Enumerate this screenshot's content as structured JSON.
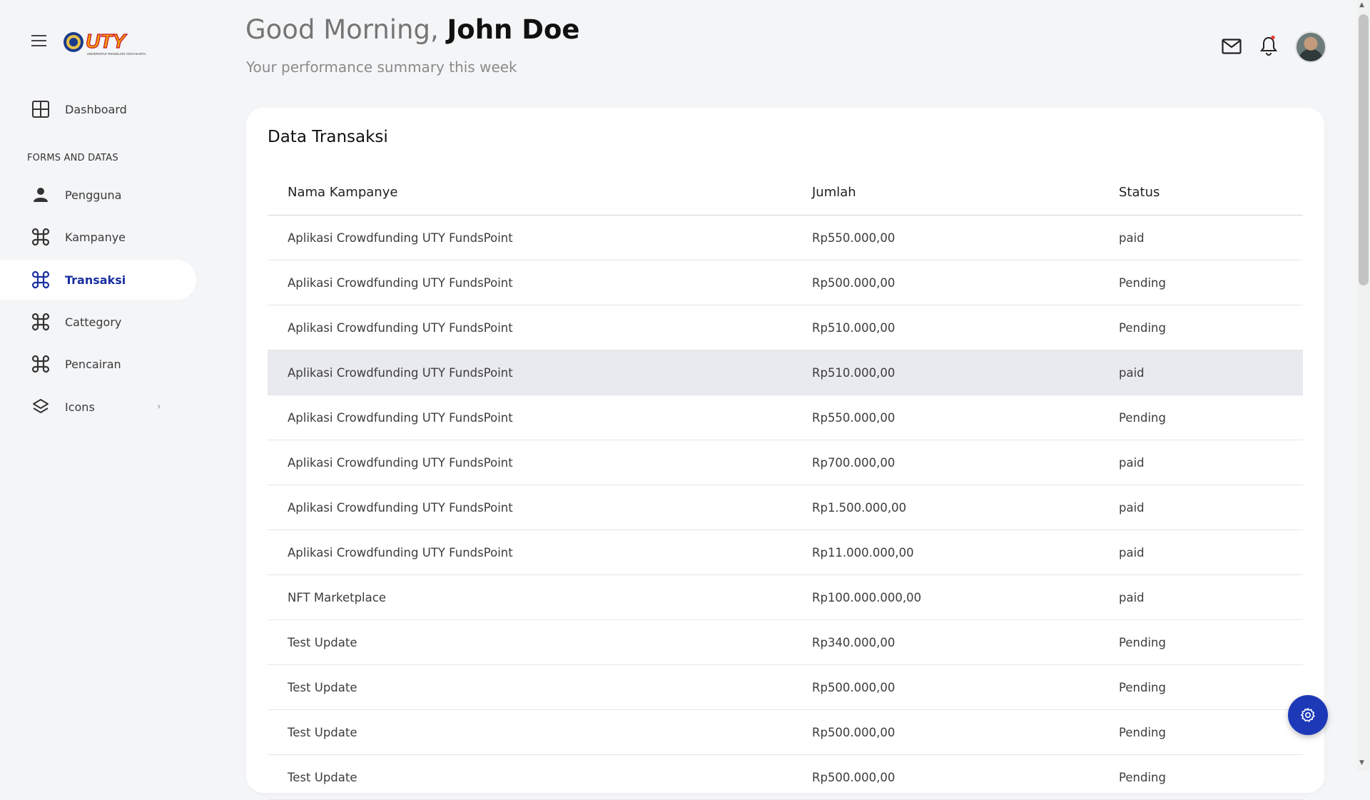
{
  "brand": {
    "logo_text": "UTY",
    "logo_subtext": "UNIVERSITAS TEKNOLOGI YOGYAKARTA"
  },
  "header": {
    "greeting": "Good Morning,",
    "user_name": "John Doe",
    "subtitle": "Your performance summary this week"
  },
  "sidebar": {
    "items_top": [
      {
        "label": "Dashboard",
        "icon": "grid-icon"
      }
    ],
    "section_title": "FORMS AND DATAS",
    "items": [
      {
        "label": "Pengguna",
        "icon": "person-icon"
      },
      {
        "label": "Kampanye",
        "icon": "command-icon"
      },
      {
        "label": "Transaksi",
        "icon": "command-icon",
        "active": true
      },
      {
        "label": "Cattegory",
        "icon": "command-icon"
      },
      {
        "label": "Pencairan",
        "icon": "command-icon"
      },
      {
        "label": "Icons",
        "icon": "layers-icon"
      }
    ]
  },
  "card": {
    "title": "Data Transaksi",
    "columns": [
      "Nama Kampanye",
      "Jumlah",
      "Status"
    ],
    "rows": [
      [
        "Aplikasi Crowdfunding UTY FundsPoint",
        "Rp550.000,00",
        "paid"
      ],
      [
        "Aplikasi Crowdfunding UTY FundsPoint",
        "Rp500.000,00",
        "Pending"
      ],
      [
        "Aplikasi Crowdfunding UTY FundsPoint",
        "Rp510.000,00",
        "Pending"
      ],
      [
        "Aplikasi Crowdfunding UTY FundsPoint",
        "Rp510.000,00",
        "paid"
      ],
      [
        "Aplikasi Crowdfunding UTY FundsPoint",
        "Rp550.000,00",
        "Pending"
      ],
      [
        "Aplikasi Crowdfunding UTY FundsPoint",
        "Rp700.000,00",
        "paid"
      ],
      [
        "Aplikasi Crowdfunding UTY FundsPoint",
        "Rp1.500.000,00",
        "paid"
      ],
      [
        "Aplikasi Crowdfunding UTY FundsPoint",
        "Rp11.000.000,00",
        "paid"
      ],
      [
        "NFT Marketplace",
        "Rp100.000.000,00",
        "paid"
      ],
      [
        "Test Update",
        "Rp340.000,00",
        "Pending"
      ],
      [
        "Test Update",
        "Rp500.000,00",
        "Pending"
      ],
      [
        "Test Update",
        "Rp500.000,00",
        "Pending"
      ],
      [
        "Test Update",
        "Rp500.000,00",
        "Pending"
      ]
    ],
    "highlighted_row": 3
  },
  "colors": {
    "accent": "#1d39b8",
    "background": "#f4f5f7",
    "card": "#ffffff"
  }
}
